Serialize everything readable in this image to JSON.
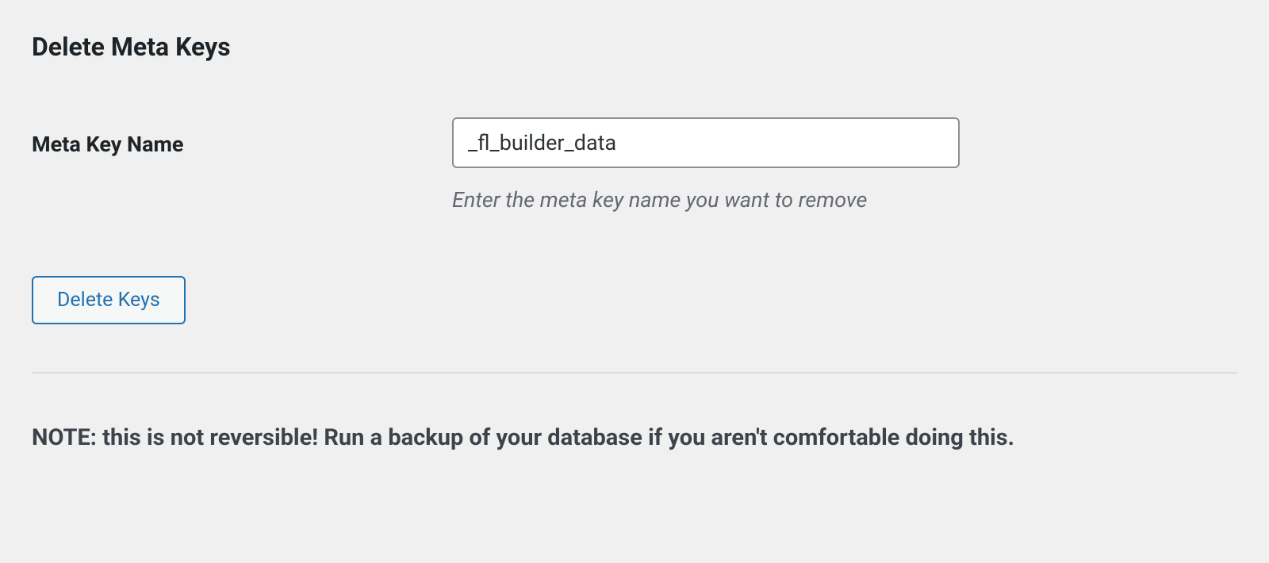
{
  "heading": "Delete Meta Keys",
  "form": {
    "meta_key_label": "Meta Key Name",
    "meta_key_value": "_fl_builder_data",
    "meta_key_description": "Enter the meta key name you want to remove"
  },
  "button": {
    "delete_keys_label": "Delete Keys"
  },
  "warning": "NOTE: this is not reversible! Run a backup of your database if you aren't comfortable doing this."
}
